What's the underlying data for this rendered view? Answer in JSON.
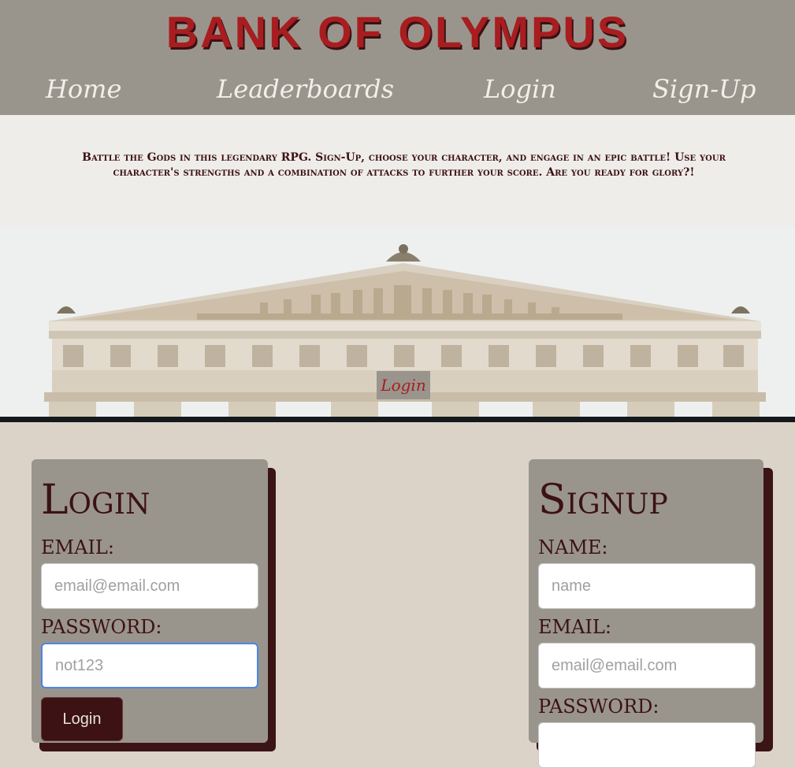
{
  "header": {
    "brand": "BANK OF OLYMPUS",
    "nav": [
      "Home",
      "Leaderboards",
      "Login",
      "Sign-Up"
    ]
  },
  "intro": {
    "text": "Battle the Gods in this legendary RPG. Sign-Up, choose your character, and engage in an epic battle! Use your character's strengths and a combination of attacks to further your score. Are you ready for glory?!"
  },
  "hero": {
    "button_label": "Login"
  },
  "login_card": {
    "title": "Login",
    "email_label": "EMAIL:",
    "email_placeholder": "email@email.com",
    "password_label": "PASSWORD:",
    "password_value": "not123",
    "submit_label": "Login"
  },
  "signup_card": {
    "title": "Signup",
    "name_label": "NAME:",
    "name_placeholder": "name",
    "email_label": "EMAIL:",
    "email_placeholder": "email@email.com",
    "password_label": "PASSWORD:"
  },
  "colors": {
    "accent": "#a81d20",
    "dark": "#3c1214",
    "panel": "#9a958c",
    "page_bg": "#dcd3c8"
  }
}
